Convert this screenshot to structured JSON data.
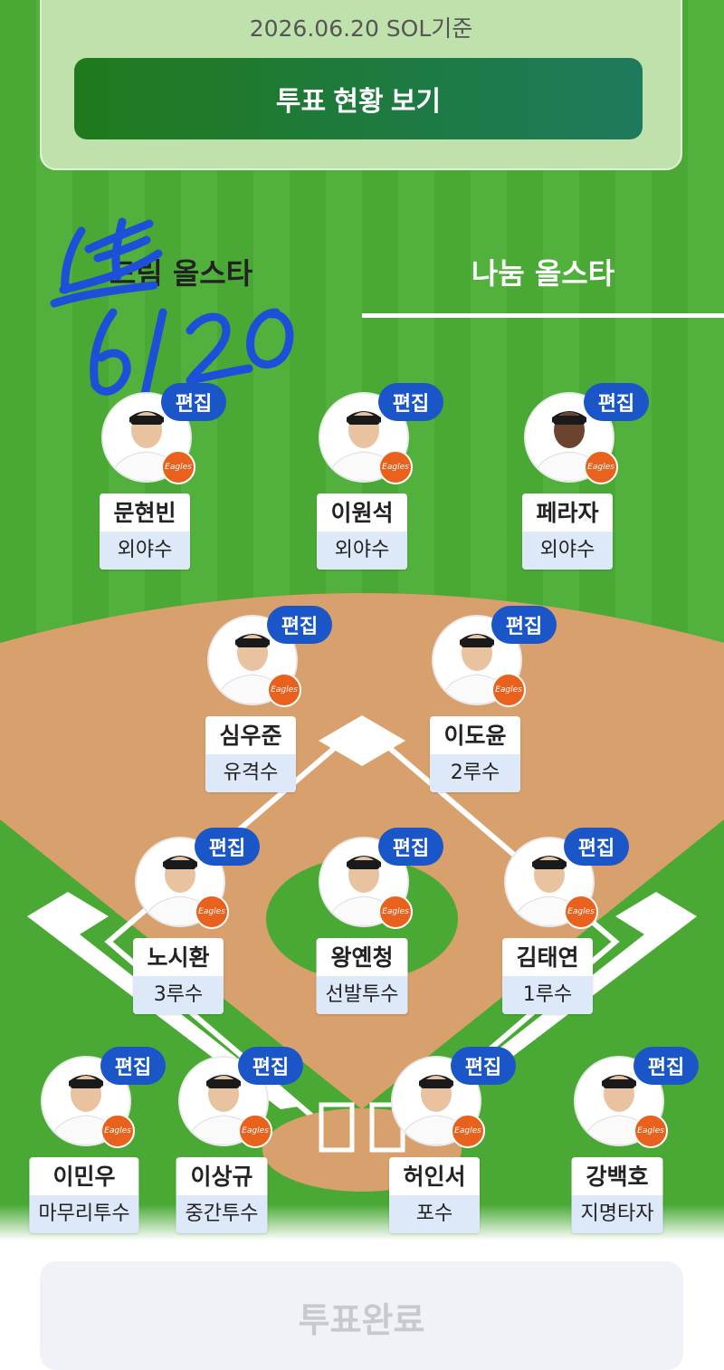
{
  "header": {
    "date_text": "2026.06.20 SOL기준",
    "vote_status_label": "투표 현황 보기"
  },
  "tabs": [
    {
      "label": "드림 올스타"
    },
    {
      "label": "나눔 올스타",
      "active": true
    }
  ],
  "overlay": {
    "handwriting": "6/20"
  },
  "edit_label": "편집",
  "team_logo_text": "Eagles",
  "players": [
    {
      "name": "문현빈",
      "position": "외야수"
    },
    {
      "name": "이원석",
      "position": "외야수"
    },
    {
      "name": "페라자",
      "position": "외야수"
    },
    {
      "name": "심우준",
      "position": "유격수"
    },
    {
      "name": "이도윤",
      "position": "2루수"
    },
    {
      "name": "노시환",
      "position": "3루수"
    },
    {
      "name": "왕옌청",
      "position": "선발투수"
    },
    {
      "name": "김태연",
      "position": "1루수"
    },
    {
      "name": "이민우",
      "position": "마무리투수"
    },
    {
      "name": "이상규",
      "position": "중간투수"
    },
    {
      "name": "허인서",
      "position": "포수"
    },
    {
      "name": "강백호",
      "position": "지명타자"
    }
  ],
  "footer": {
    "complete_label": "투표완료"
  },
  "colors": {
    "accent": "#1a56c8",
    "grass": "#49a934",
    "dirt": "#d7a06c"
  }
}
